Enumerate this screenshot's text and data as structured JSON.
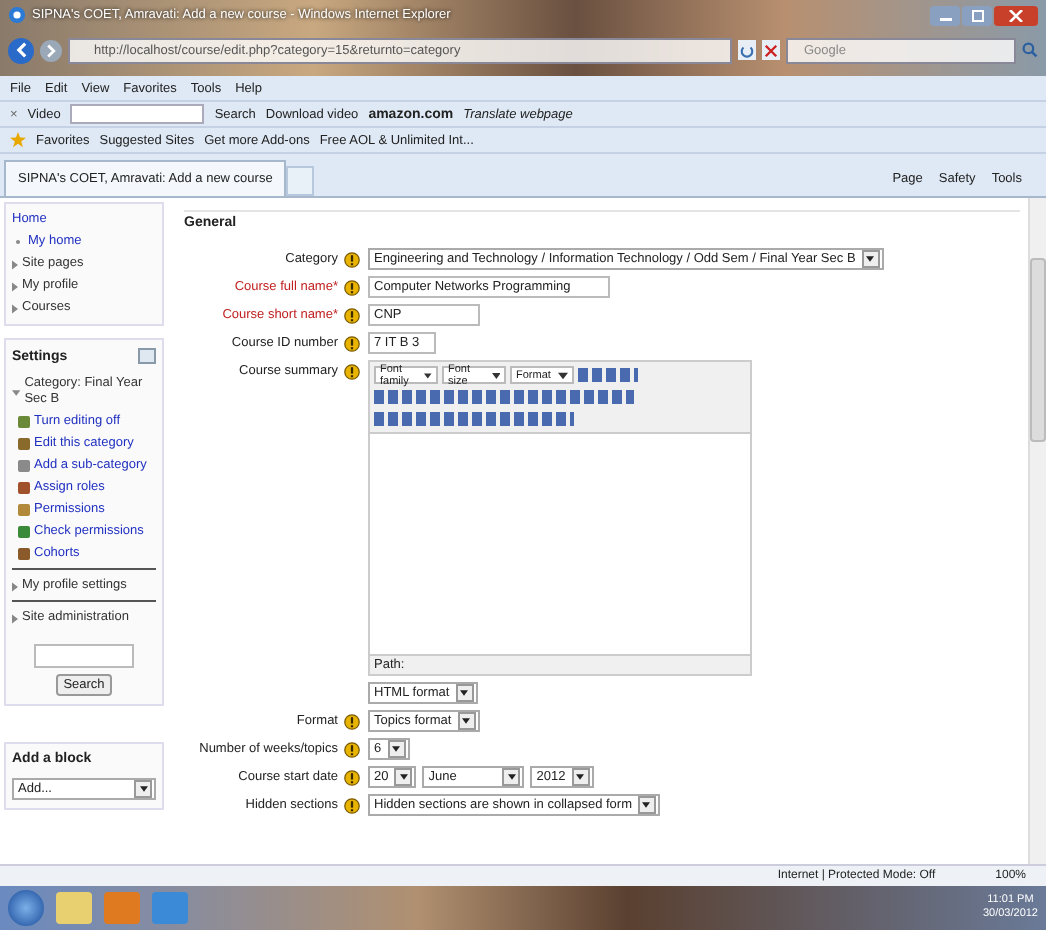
{
  "window": {
    "title": "SIPNA's COET, Amravati: Add a new course - Windows Internet Explorer"
  },
  "address_bar": {
    "url": "http://localhost/course/edit.php?category=15&returnto=category",
    "search_placeholder": "Google"
  },
  "menu_bar": [
    "File",
    "Edit",
    "View",
    "Favorites",
    "Tools",
    "Help"
  ],
  "toolbar": {
    "close": "×",
    "video": "Video",
    "search": "Search",
    "download": "Download video",
    "amazon": "amazon.com",
    "translate": "Translate webpage"
  },
  "favorites_bar": {
    "favorites": "Favorites",
    "items": [
      "Suggested Sites",
      "Get more Add-ons",
      "Free AOL & Unlimited Int..."
    ]
  },
  "tab": {
    "title": "SIPNA's COET, Amravati: Add a new course"
  },
  "command_bar": [
    "Page",
    "Safety",
    "Tools"
  ],
  "navigation": {
    "items": [
      {
        "label": "Home",
        "kind": "link"
      },
      {
        "label": "My home",
        "kind": "bullet"
      },
      {
        "label": "Site pages",
        "kind": "collapsed"
      },
      {
        "label": "My profile",
        "kind": "collapsed"
      },
      {
        "label": "Courses",
        "kind": "collapsed"
      }
    ]
  },
  "settings": {
    "title": "Settings",
    "category": {
      "label": "Category: Final Year Sec B",
      "expanded": true,
      "children": [
        "Turn editing off",
        "Edit this category",
        "Add a sub-category",
        "Assign roles",
        "Permissions",
        "Check permissions",
        "Cohorts"
      ]
    },
    "collapsed": [
      "My profile settings",
      "Site administration"
    ],
    "search_button": "Search"
  },
  "add_block": {
    "title": "Add a block",
    "select": "Add..."
  },
  "form": {
    "legend": "General",
    "fields": [
      {
        "kind": "select",
        "label": "Category",
        "required": false,
        "value": "Engineering and Technology / Information Technology / Odd Sem / Final Year Sec B"
      },
      {
        "kind": "text",
        "label": "Course full name*",
        "required": true,
        "value": "Computer Networks Programming"
      },
      {
        "kind": "text",
        "label": "Course short name*",
        "required": true,
        "value": "CNP"
      },
      {
        "kind": "text",
        "label": "Course ID number",
        "required": false,
        "value": "7 IT B 3"
      },
      {
        "kind": "editor",
        "label": "Course summary",
        "required": false,
        "font_family": "Font family",
        "font_size": "Font size",
        "format": "Format",
        "path": "Path:",
        "text_format": "HTML format"
      },
      {
        "kind": "select",
        "label": "Format",
        "required": false,
        "value": "Topics format"
      },
      {
        "kind": "select",
        "label": "Number of weeks/topics",
        "required": false,
        "value": "6"
      },
      {
        "kind": "date",
        "label": "Course start date",
        "required": false,
        "day": "20",
        "month": "June",
        "year": "2012"
      },
      {
        "kind": "select",
        "label": "Hidden sections",
        "required": false,
        "value": "Hidden sections are shown in collapsed form"
      }
    ]
  },
  "status_bar": {
    "zone": "Internet | Protected Mode: Off",
    "zoom": "100%"
  },
  "taskbar": {
    "time": "11:01 PM",
    "date": "30/03/2012"
  }
}
